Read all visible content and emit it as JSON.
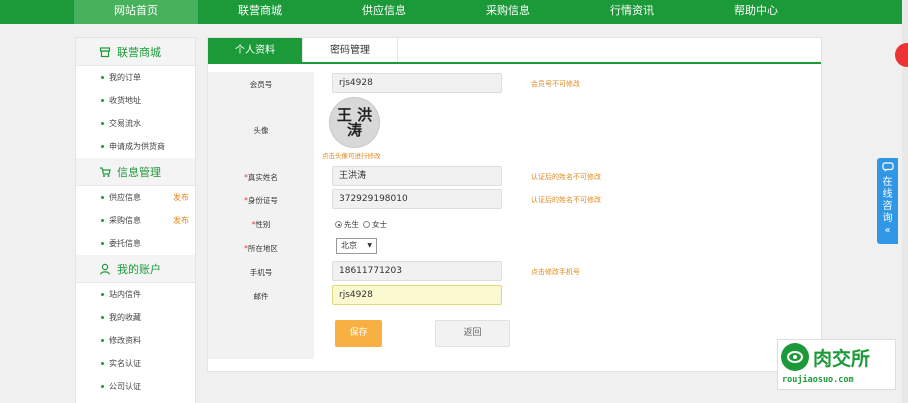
{
  "nav": {
    "items": [
      "网站首页",
      "联营商城",
      "供应信息",
      "采购信息",
      "行情资讯",
      "帮助中心"
    ]
  },
  "sidebar": {
    "sections": [
      {
        "title": "联营商城",
        "icon": "shop-icon",
        "items": [
          {
            "label": "我的订单",
            "tag": ""
          },
          {
            "label": "收货地址",
            "tag": ""
          },
          {
            "label": "交易流水",
            "tag": ""
          },
          {
            "label": "申请成为供货商",
            "tag": ""
          }
        ]
      },
      {
        "title": "信息管理",
        "icon": "cart-icon",
        "items": [
          {
            "label": "供应信息",
            "tag": "发布"
          },
          {
            "label": "采购信息",
            "tag": "发布"
          },
          {
            "label": "委托信息",
            "tag": ""
          }
        ]
      },
      {
        "title": "我的账户",
        "icon": "user-icon",
        "items": [
          {
            "label": "站内信件",
            "tag": ""
          },
          {
            "label": "我的收藏",
            "tag": ""
          },
          {
            "label": "修改资料",
            "tag": ""
          },
          {
            "label": "实名认证",
            "tag": ""
          },
          {
            "label": "公司认证",
            "tag": ""
          }
        ]
      }
    ]
  },
  "tabs": [
    "个人资料",
    "密码管理"
  ],
  "form": {
    "member_label": "会员号",
    "member_value": "rjs4928",
    "member_note": "会员号不可修改",
    "avatar_label": "头像",
    "avatar_chars": "王 洪 涛",
    "avatar_tip": "点击头像可进行修改",
    "realname_label": "真实姓名",
    "realname_value": "王洪涛",
    "realname_note": "认证后的姓名不可修改",
    "id_label": "身份证号",
    "id_value": "372929198010",
    "id_note": "认证后的姓名不可修改",
    "gender_label": "性别",
    "gender_male": "先生",
    "gender_female": "女士",
    "region_label": "所在地区",
    "region_value": "北京",
    "phone_label": "手机号",
    "phone_value": "18611771203",
    "phone_note": "点击修改手机号",
    "email_label": "邮件",
    "email_value": "rjs4928",
    "save_label": "保存",
    "back_label": "返回"
  },
  "float": {
    "online_text": "在线咨询",
    "chevron": "«"
  },
  "watermark": {
    "brand": "肉交所",
    "domain": "roujiaosuo.com"
  }
}
